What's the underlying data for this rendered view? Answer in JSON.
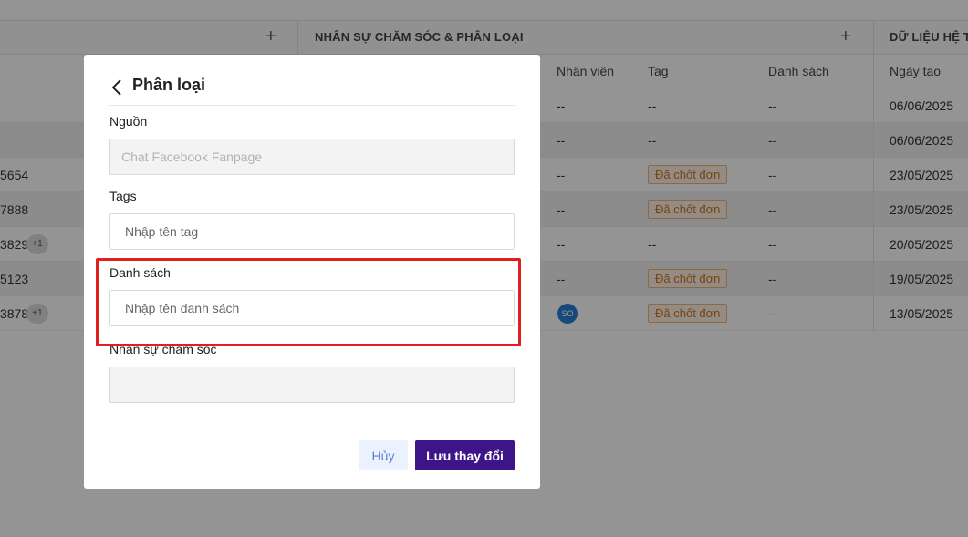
{
  "background": {
    "groups": [
      {
        "title": "NHÂN SỰ CHĂM SÓC & PHÂN LOẠI",
        "plus": "+"
      },
      {
        "title": "DỮ LIỆU HỆ THỐNG",
        "plus": "+"
      }
    ],
    "first_group_plus": "+",
    "columns": [
      "Nhân viên",
      "Tag",
      "Danh sách",
      "Ngày tạo"
    ],
    "rows": [
      {
        "left": "",
        "badge": "",
        "staff": "--",
        "tag": "--",
        "list": "--",
        "date": "06/06/2025"
      },
      {
        "left": "",
        "badge": "",
        "staff": "--",
        "tag": "--",
        "list": "--",
        "date": "06/06/2025"
      },
      {
        "left": "5654",
        "badge": "",
        "staff": "--",
        "tag": "Đã chốt đơn",
        "list": "--",
        "date": "23/05/2025"
      },
      {
        "left": "7888",
        "badge": "",
        "staff": "--",
        "tag": "Đã chốt đơn",
        "list": "--",
        "date": "23/05/2025"
      },
      {
        "left": "3829",
        "badge": "+1",
        "staff": "--",
        "tag": "--",
        "list": "--",
        "date": "20/05/2025"
      },
      {
        "left": "5123",
        "badge": "",
        "staff": "--",
        "tag": "Đã chốt đơn",
        "list": "--",
        "date": "19/05/2025"
      },
      {
        "left": "3878",
        "badge": "+1",
        "staff": "SO",
        "tag": "Đã chốt đơn",
        "list": "--",
        "date": "13/05/2025"
      }
    ]
  },
  "modal": {
    "title": "Phân loại",
    "source_label": "Nguồn",
    "source_value": "Chat Facebook Fanpage",
    "tags_label": "Tags",
    "tags_placeholder": "Nhập tên tag",
    "list_label": "Danh sách",
    "list_placeholder": "Nhập tên danh sách",
    "staff_label": "Nhân sự chăm sóc",
    "staff_value": "",
    "cancel_label": "Hủy",
    "save_label": "Lưu thay đổi"
  },
  "colors": {
    "primary": "#3d1588",
    "highlight": "#e0201e",
    "tag_text": "#c9771b"
  }
}
